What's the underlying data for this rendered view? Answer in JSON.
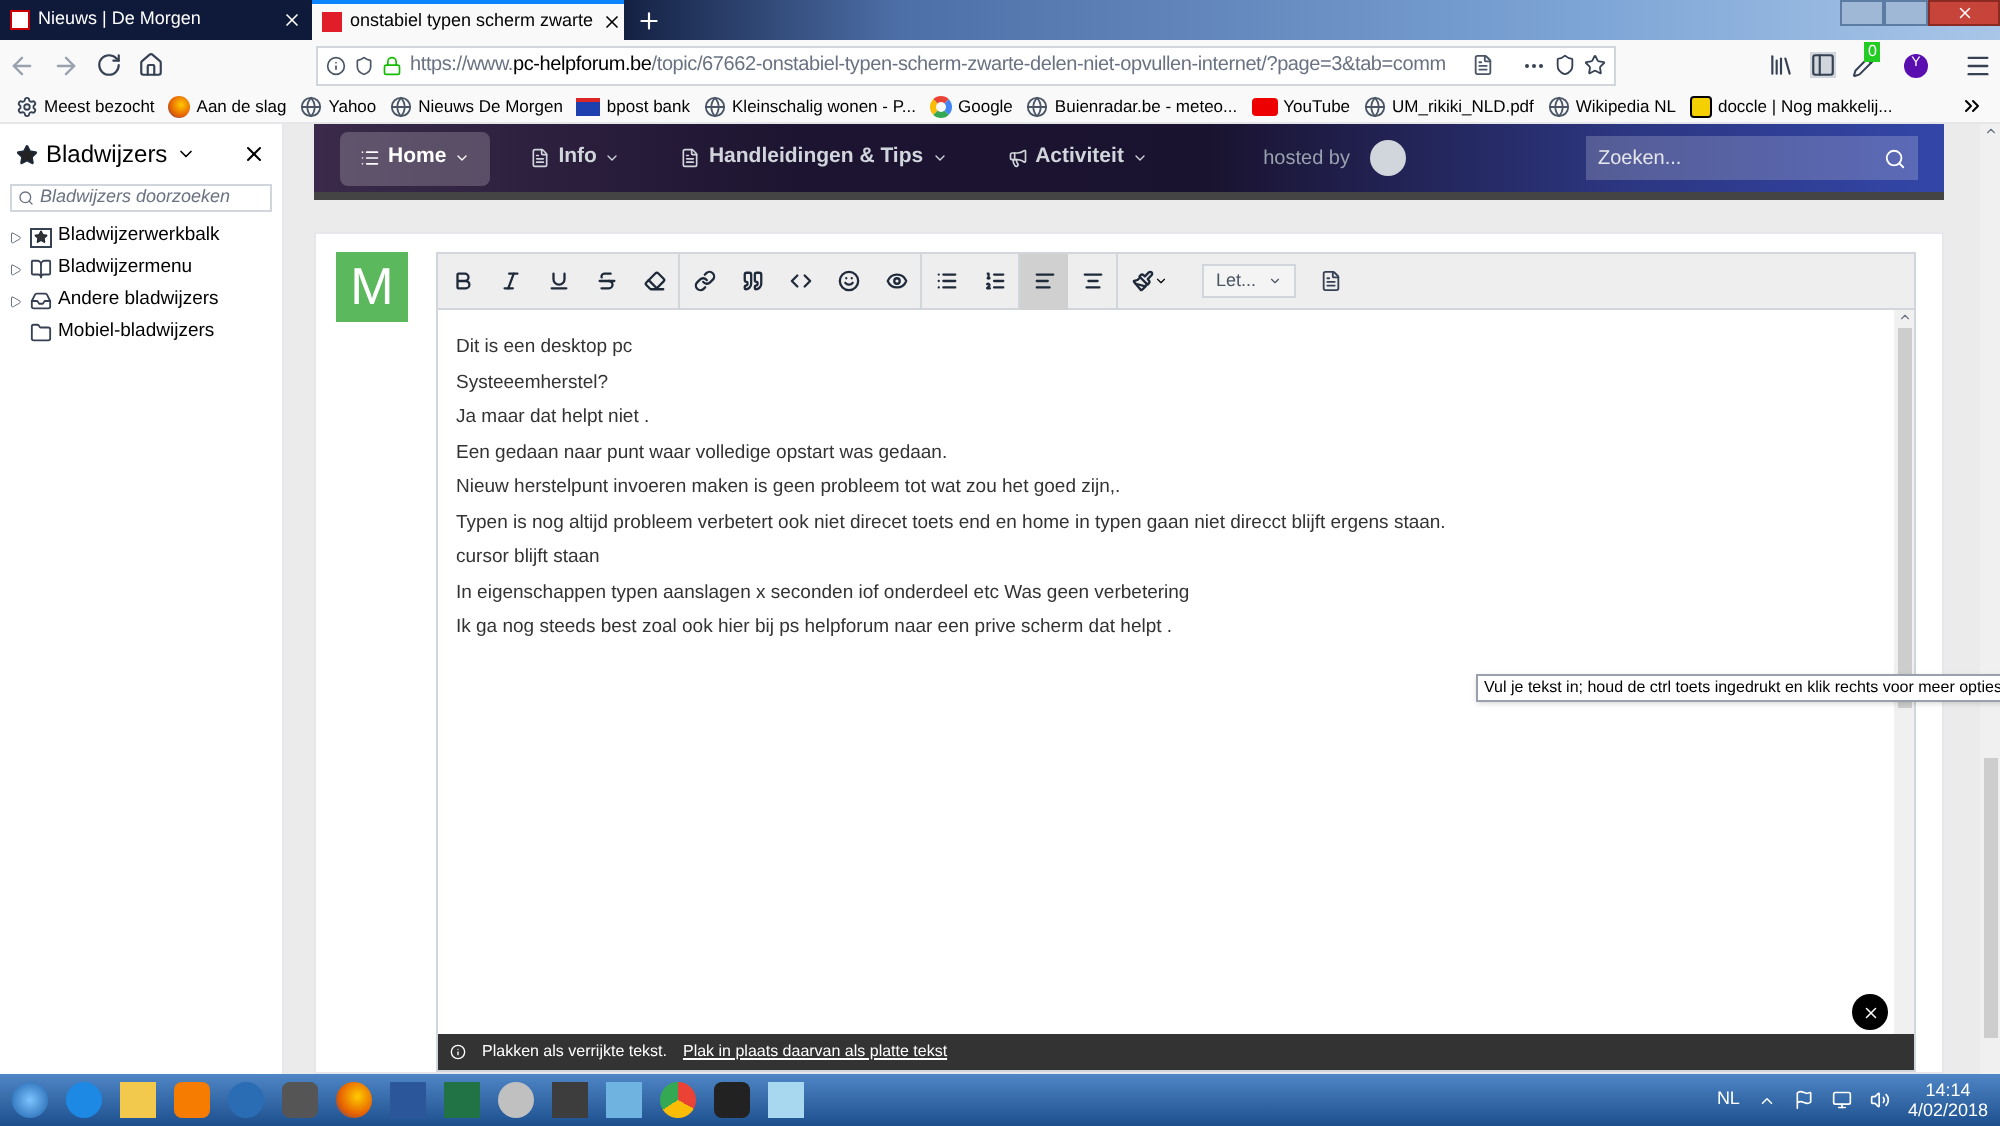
{
  "tabs": [
    {
      "title": "Nieuws | De Morgen",
      "selected": false
    },
    {
      "title": "onstabiel typen scherm zwarte",
      "selected": true
    }
  ],
  "address_bar": {
    "prefix": "https://www.",
    "domain": "pc-helpforum.be",
    "path": "/topic/67662-onstabiel-typen-scherm-zwarte-delen-niet-opvullen-internet/?page=3&tab=comm"
  },
  "extension_badge": "0",
  "account_initial": "Y",
  "bookmarks": [
    {
      "label": "Meest bezocht",
      "kind": "gear"
    },
    {
      "label": "Aan de slag",
      "kind": "firefox"
    },
    {
      "label": "Yahoo",
      "kind": "globe"
    },
    {
      "label": "Nieuws  De Morgen",
      "kind": "globe"
    },
    {
      "label": "bpost bank",
      "kind": "bank"
    },
    {
      "label": "Kleinschalig wonen - P...",
      "kind": "globe"
    },
    {
      "label": "Google",
      "kind": "google"
    },
    {
      "label": "Buienradar.be - meteo...",
      "kind": "globe"
    },
    {
      "label": "YouTube",
      "kind": "youtube"
    },
    {
      "label": "UM_rikiki_NLD.pdf",
      "kind": "globe"
    },
    {
      "label": "Wikipedia NL",
      "kind": "globe"
    },
    {
      "label": "doccle | Nog makkelij...",
      "kind": "doccle"
    }
  ],
  "sidebar": {
    "title": "Bladwijzers",
    "search_placeholder": "Bladwijzers doorzoeken",
    "items": [
      {
        "label": "Bladwijzerwerkbalk",
        "kind": "toolbar",
        "expandable": true
      },
      {
        "label": "Bladwijzermenu",
        "kind": "menu",
        "expandable": true
      },
      {
        "label": "Andere bladwijzers",
        "kind": "other",
        "expandable": true
      },
      {
        "label": "Mobiel-bladwijzers",
        "kind": "folder",
        "expandable": false
      }
    ]
  },
  "site_nav": {
    "items": [
      {
        "label": "Home",
        "selected": true
      },
      {
        "label": "Info",
        "selected": false
      },
      {
        "label": "Handleidingen & Tips",
        "selected": false
      },
      {
        "label": "Activiteit",
        "selected": false
      }
    ],
    "hosted_by": "hosted by",
    "search_placeholder": "Zoeken..."
  },
  "avatar_initial": "M",
  "editor": {
    "toolbar": [
      {
        "selected": false
      },
      {
        "selected": false
      },
      {
        "selected": false
      },
      {
        "selected": false
      },
      {
        "selected": false
      },
      {
        "selected": false
      },
      {
        "selected": false
      },
      {
        "selected": false
      },
      {
        "selected": false
      },
      {
        "selected": false
      },
      {
        "selected": false
      },
      {
        "selected": false
      },
      {
        "selected": true
      },
      {
        "selected": false
      },
      {
        "selected": false
      }
    ],
    "font_dropdown": "Let...",
    "lines": [
      "Dit is een desktop pc",
      "Systeeemherstel?",
      "Ja maar dat helpt niet .",
      "Een gedaan naar punt waar volledige opstart was gedaan.",
      "Nieuw herstelpunt invoeren maken  is geen probleem tot wat zou het goed zijn,.",
      "Typen is nog altijd probleem verbetert ook niet direcet  toets end en home in typen gaan niet  direcct blijft ergens staan.",
      "cursor blijft staan",
      "In eigenschappen typen aanslagen x seconden iof onderdeel  etc  Was geen verbetering",
      "Ik ga nog steeds best zoal ook hier bij ps helpforum naar een prive scherm dat helpt ."
    ],
    "tooltip": "Vul je tekst in; houd de ctrl toets ingedrukt en klik rechts voor meer opties",
    "paste_notice": "Plakken als verrijkte tekst.",
    "paste_link": "Plak in plaats daarvan als platte tekst"
  },
  "taskbar": {
    "language": "NL",
    "time": "14:14",
    "date": "4/02/2018"
  }
}
